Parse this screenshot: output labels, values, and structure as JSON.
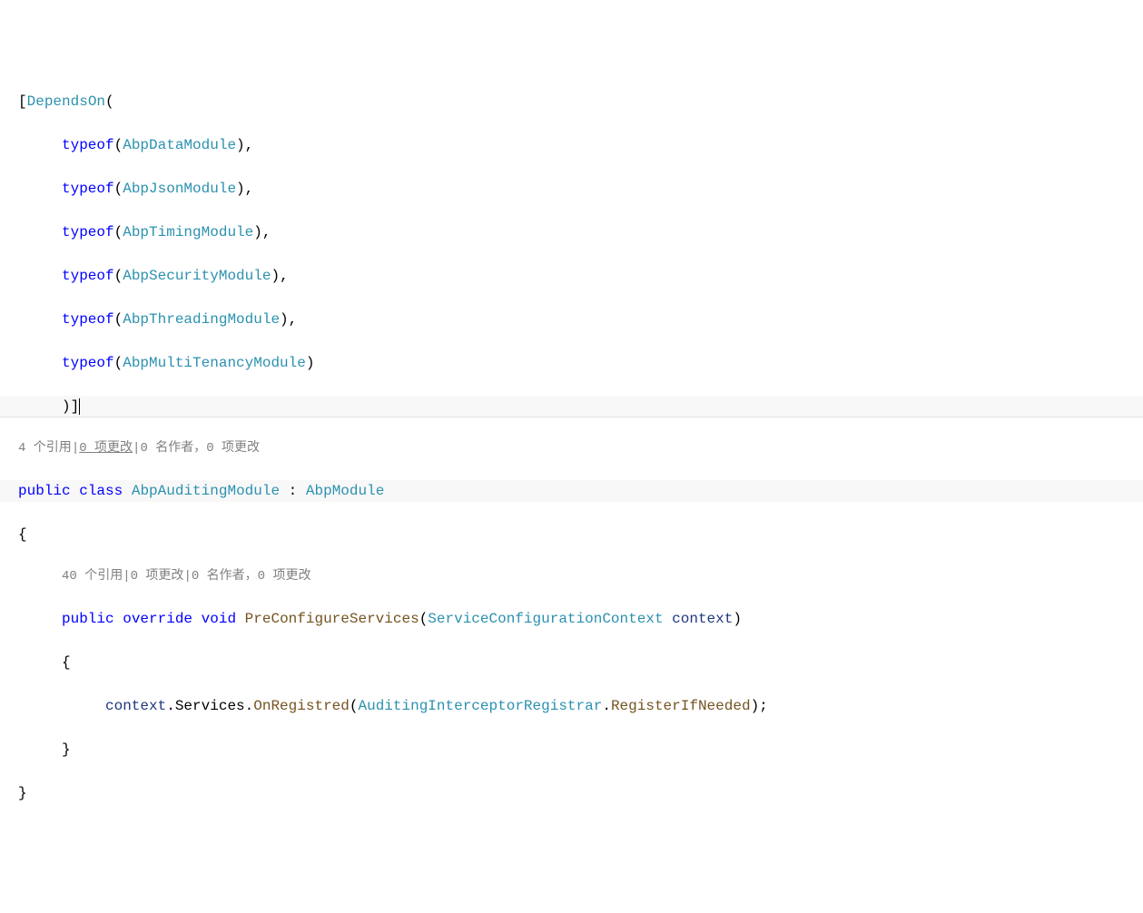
{
  "code": {
    "lbracket": "[",
    "dependson": "DependsOn",
    "lparen": "(",
    "rparen": ")",
    "comma": ",",
    "semicolon": ";",
    "typeof": "typeof",
    "modules": {
      "m1": "AbpDataModule",
      "m2": "AbpJsonModule",
      "m3": "AbpTimingModule",
      "m4": "AbpSecurityModule",
      "m5": "AbpThreadingModule",
      "m6": "AbpMultiTenancyModule"
    },
    "rbracket_close": ")]",
    "codelens_class": {
      "refs": "4 个引用",
      "sep1": "|",
      "changes_link": "0 项更改",
      "sep2": "|",
      "authors": "0 名作者，0 项更改"
    },
    "public": "public",
    "class": "class",
    "classname": "AbpAuditingModule",
    "colon": " : ",
    "basename": "AbpModule",
    "lbrace": "{",
    "rbrace": "}",
    "codelens_method": {
      "refs": "40 个引用",
      "sep1": "|",
      "changes": "0 项更改",
      "sep2": "|",
      "authors": "0 名作者，0 项更改"
    },
    "override": "override",
    "void": "void",
    "methodname": "PreConfigureServices",
    "paramtype": "ServiceConfigurationContext",
    "paramname": " context",
    "body_context": "context",
    "dot": ".",
    "body_services": "Services",
    "body_onregistred": "OnRegistred",
    "body_registrar": "AuditingInterceptorRegistrar",
    "body_registerif": "RegisterIfNeeded"
  }
}
